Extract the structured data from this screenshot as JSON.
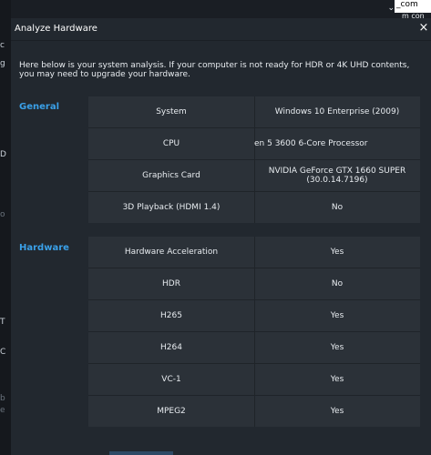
{
  "background": {
    "left_fragments": [
      "c",
      "g",
      "D",
      "o",
      "T",
      "C",
      "b",
      "e"
    ],
    "topright_fragments": [
      "_com",
      "⌄",
      "m con"
    ]
  },
  "dialog": {
    "title": "Analyze Hardware",
    "close_glyph": "×",
    "intro": "Here below is your system analysis. If your computer is not ready for HDR or 4K UHD contents, you may need to upgrade your hardware.",
    "general": {
      "label": "General",
      "rows": [
        {
          "name": "System",
          "value": "Windows 10 Enterprise (2009)"
        },
        {
          "name": "CPU",
          "value": "en 5 3600 6-Core Processor"
        },
        {
          "name": "Graphics Card",
          "value": "NVIDIA GeForce GTX 1660 SUPER (30.0.14.7196)"
        },
        {
          "name": "3D Playback (HDMI 1.4)",
          "value": "No"
        }
      ]
    },
    "hardware": {
      "label": "Hardware",
      "rows": [
        {
          "name": "Hardware Acceleration",
          "value": "Yes"
        },
        {
          "name": "HDR",
          "value": "No"
        },
        {
          "name": "H265",
          "value": "Yes"
        },
        {
          "name": "H264",
          "value": "Yes"
        },
        {
          "name": "VC-1",
          "value": "Yes"
        },
        {
          "name": "MPEG2",
          "value": "Yes"
        }
      ]
    }
  },
  "colors": {
    "accent": "#3aa0e8",
    "dialog_bg": "#22282f",
    "table_bg": "#2b3138"
  }
}
